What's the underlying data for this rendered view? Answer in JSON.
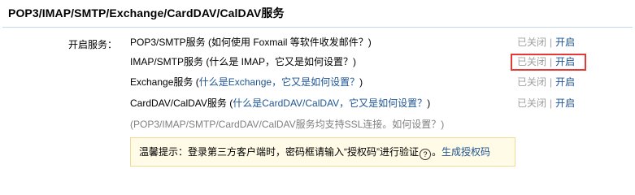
{
  "section": {
    "title": "POP3/IMAP/SMTP/Exchange/CardDAV/CalDAV服务"
  },
  "services_label": "开启服务：",
  "services": [
    {
      "name": "POP3/SMTP服务",
      "help_prefix": " (如何使用 Foxmail 等软件收发邮件？)",
      "help_link": "",
      "help_suffix": "",
      "status_off": "已关闭",
      "separator": "|",
      "status_on": "开启"
    },
    {
      "name": "IMAP/SMTP服务",
      "help_prefix": " (什么是 IMAP，它又是如何设置？)",
      "help_link": "",
      "help_suffix": "",
      "status_off": "已关闭",
      "separator": "|",
      "status_on": "开启"
    },
    {
      "name": "Exchange服务",
      "help_prefix": " (",
      "help_link": "什么是Exchange，它又是如何设置？",
      "help_suffix": ")",
      "status_off": "已关闭",
      "separator": "|",
      "status_on": "开启"
    },
    {
      "name": "CardDAV/CalDAV服务",
      "help_prefix": " (",
      "help_link": "什么是CardDAV/CalDAV，它又是如何设置？",
      "help_suffix": ")",
      "status_off": "已关闭",
      "separator": "|",
      "status_on": "开启"
    }
  ],
  "ssl_note": "(POP3/IMAP/SMTP/CardDAV/CalDAV服务均支持SSL连接。如何设置？)",
  "tip": {
    "text_before": "温馨提示：登录第三方客户端时，密码框请输入“授权码”进行验证",
    "help_icon": "?",
    "text_after": "。",
    "link": "生成授权码"
  },
  "colors": {
    "link": "#1e5494",
    "disabled": "#a0a0a0",
    "highlight": "#e53935",
    "tip_background": "#fffbe6",
    "tip_border": "#f1d996",
    "rule": "#c6d8ea"
  }
}
